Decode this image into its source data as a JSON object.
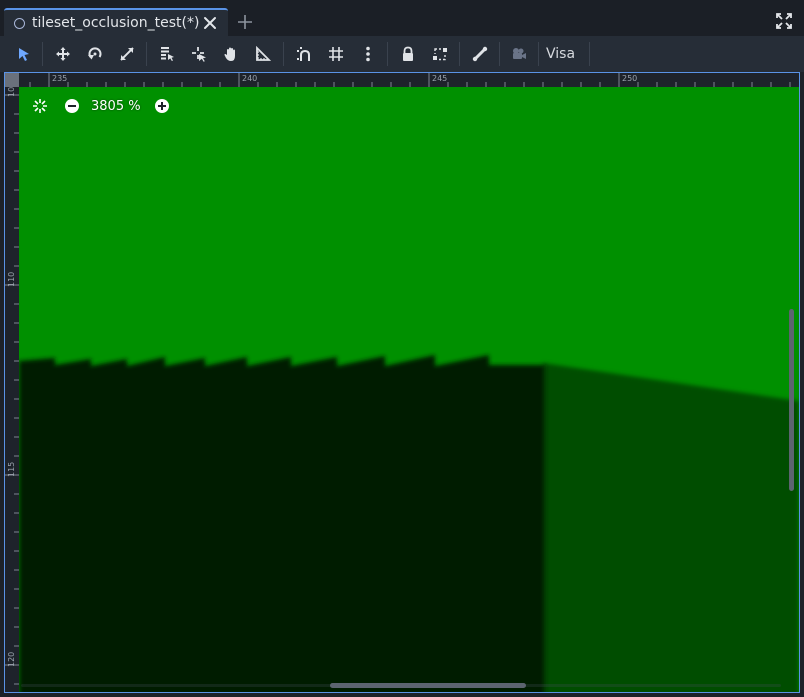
{
  "tab": {
    "title": "tileset_occlusion_test(*)"
  },
  "toolbar": {
    "tools": [
      "select-icon",
      "move-icon",
      "rotate-icon",
      "scale-icon",
      "list-select-icon",
      "pivot-icon",
      "pan-icon",
      "ruler-icon",
      "smart-snap-icon",
      "grid-snap-icon",
      "more-vertical-icon",
      "lock-icon",
      "group-icon",
      "bone-icon",
      "camera-icon"
    ],
    "view_menu": "Visa"
  },
  "viewport": {
    "zoom": "3805 %",
    "ruler_top_labels": [
      "235",
      "240",
      "245",
      "250"
    ],
    "ruler_left_labels": [
      "105",
      "110",
      "115",
      "120"
    ]
  },
  "colors": {
    "accent": "#5a93e6",
    "green_bright": "#009000",
    "green_dark": "#001c00",
    "green_mid": "#004e00",
    "panel_bg": "#262d37"
  }
}
